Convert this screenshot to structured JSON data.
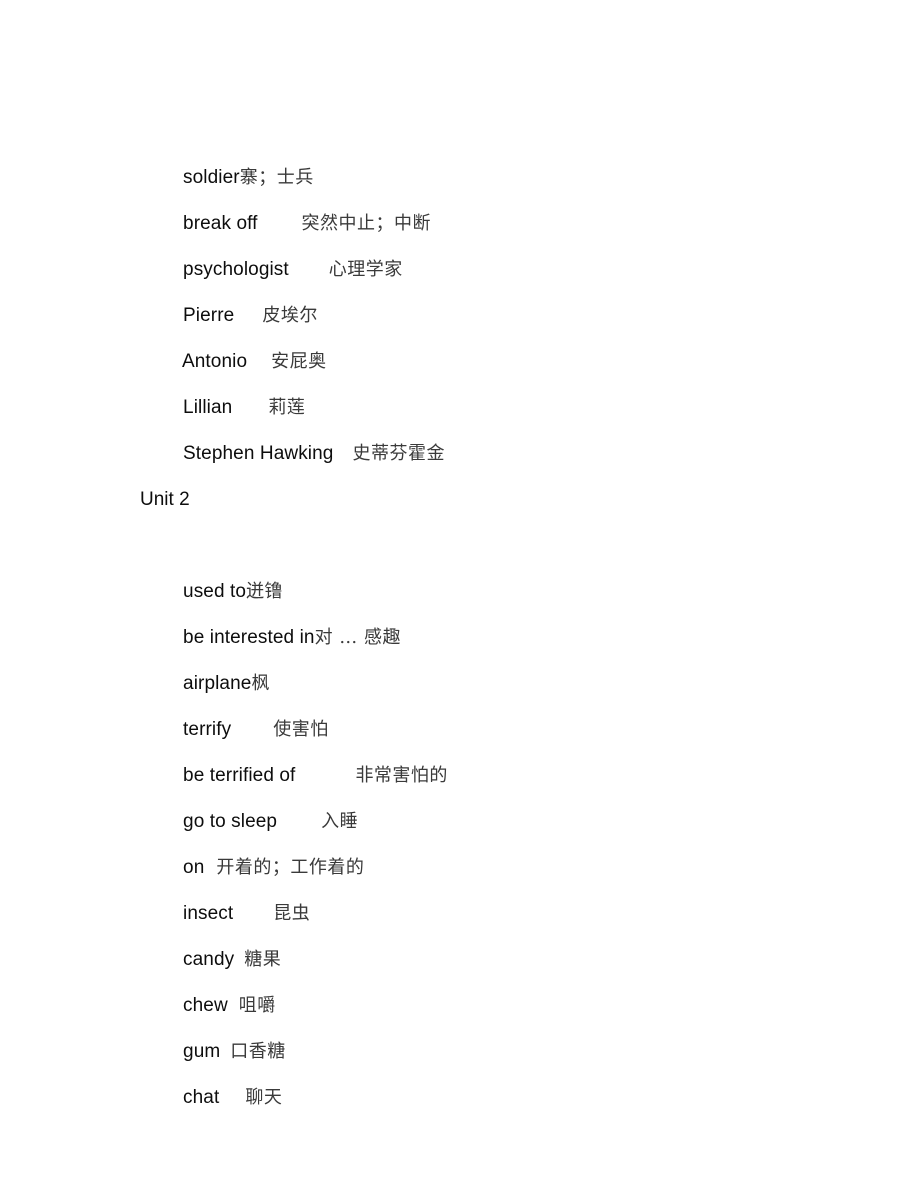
{
  "document": {
    "page_background": "#ffffff",
    "text_color_latin": "#0d0d0d",
    "text_color_cjk": "#3a3a3a",
    "entries": [
      {
        "en": "soldier",
        "gap": 0,
        "cn": "寨；士兵"
      },
      {
        "en": "break off",
        "gap": 44,
        "cn": "突然中止；中断"
      },
      {
        "en": "psychologist",
        "gap": 40,
        "cn": "心理学家"
      },
      {
        "en": "Pierre",
        "gap": 28,
        "cn": "皮埃尔"
      },
      {
        "en": "Antonio",
        "gap": 24,
        "cn": "安屁奥"
      },
      {
        "en": "Lillian",
        "gap": 36,
        "cn": "莉莲"
      },
      {
        "en": "Stephen Hawking",
        "gap": 19,
        "cn": "史蒂芬霍金"
      }
    ],
    "unit_heading": "Unit 2",
    "unit2_entries": [
      {
        "en": "used to",
        "gap": 0,
        "cn": "迸镥"
      },
      {
        "en": "be interested in",
        "gap": 0,
        "cn": "对 … 感趣"
      },
      {
        "en": "airplane",
        "gap": 0,
        "cn": "枫"
      },
      {
        "en": "terrify",
        "gap": 42,
        "cn": "使害怕"
      },
      {
        "en": "be terrified of",
        "gap": 60,
        "cn": "非常害怕的"
      },
      {
        "en": "go to sleep",
        "gap": 44,
        "cn": "入睡"
      },
      {
        "en": "on",
        "gap": 12,
        "cn": "开着的；工作着的"
      },
      {
        "en": "insect",
        "gap": 40,
        "cn": "昆虫"
      },
      {
        "en": "candy",
        "gap": 10,
        "cn": "糖果"
      },
      {
        "en": "chew",
        "gap": 11,
        "cn": "咀嚼"
      },
      {
        "en": "gum",
        "gap": 10,
        "cn": "口香糖"
      },
      {
        "en": "chat",
        "gap": 26,
        "cn": "聊天"
      }
    ]
  }
}
